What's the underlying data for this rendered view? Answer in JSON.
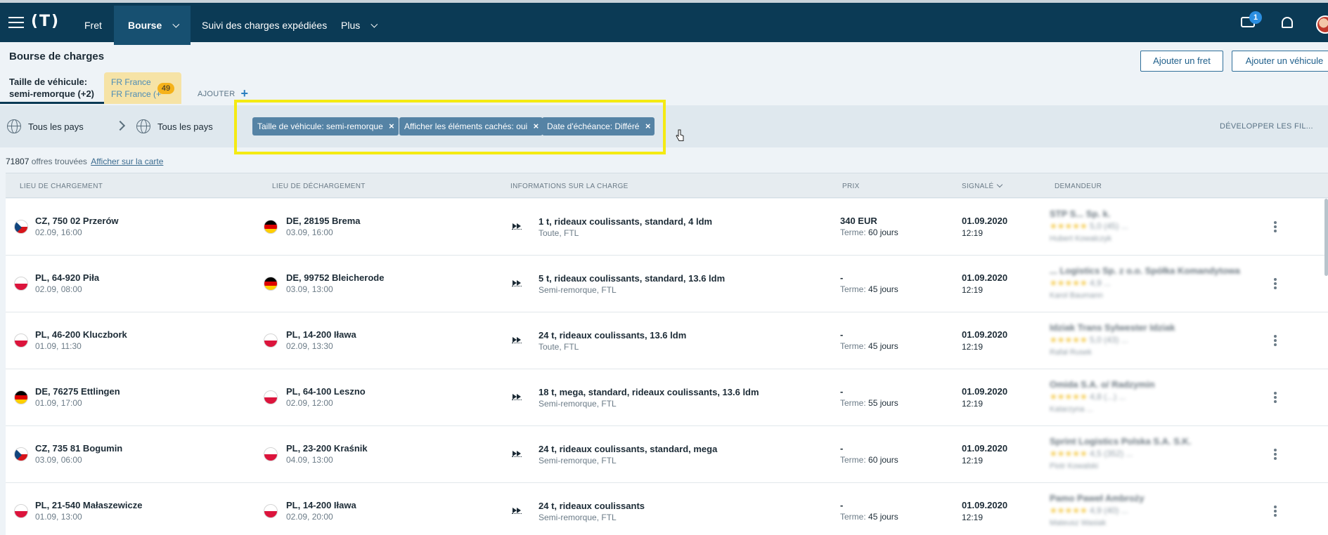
{
  "nav": {
    "logo": "(T)",
    "items": [
      {
        "label": "Fret",
        "active": false,
        "dropdown": false
      },
      {
        "label": "Bourse",
        "active": true,
        "dropdown": true
      },
      {
        "label": "Suivi des charges expédiées",
        "active": false,
        "dropdown": false
      },
      {
        "label": "Plus",
        "active": false,
        "dropdown": true
      }
    ],
    "messages_badge": "1"
  },
  "header": {
    "title": "Bourse de charges",
    "add_freight": "Ajouter un fret",
    "add_vehicle": "Ajouter un véhicule"
  },
  "tabs": {
    "size_line1": "Taille de véhicule:",
    "size_line2": "semi-remorque (+2)",
    "fr_line1": "FR France",
    "fr_line2": "FR France (+",
    "fr_count": "49",
    "add_label": "AJOUTER"
  },
  "filters": {
    "from_country": "Tous les pays",
    "to_country": "Tous les pays",
    "chips": [
      "Taille de véhicule: semi-remorque",
      "Afficher les éléments cachés: oui",
      "Date d'échéance: Différé"
    ],
    "expand_label": "DÉVELOPPER LES FIL..."
  },
  "results": {
    "count": "71807",
    "count_suffix": "offres trouvées",
    "map_link": "Afficher sur la carte"
  },
  "columns": {
    "loading": "LIEU DE CHARGEMENT",
    "unloading": "LIEU DE DÉCHARGEMENT",
    "info": "INFORMATIONS SUR LA CHARGE",
    "price": "PRIX",
    "reported": "SIGNALÉ",
    "requester": "DEMANDEUR"
  },
  "rows": [
    {
      "from_flag": "cz",
      "from": "CZ, 750 02 Przerów",
      "from_date": "02.09, 16:00",
      "to_flag": "de",
      "to": "DE, 28195 Brema",
      "to_date": "03.09, 16:00",
      "info": "1 t, rideaux coulissants, standard, 4 ldm",
      "info_sub": "Toute, FTL",
      "price": "340 EUR",
      "term_label": "Terme:",
      "term": "60 jours",
      "date": "01.09.2020",
      "time": "12:19",
      "req_name": "STP S... Sp. k.",
      "req_rating": "5,0 (45) ...",
      "req_person": "Hubert Kowalczyk"
    },
    {
      "from_flag": "pl",
      "from": "PL, 64-920 Piła",
      "from_date": "02.09, 08:00",
      "to_flag": "de",
      "to": "DE, 99752 Bleicherode",
      "to_date": "03.09, 13:00",
      "info": "5 t, rideaux coulissants, standard, 13.6 ldm",
      "info_sub": "Semi-remorque, FTL",
      "price": "-",
      "term_label": "Terme:",
      "term": "45 jours",
      "date": "01.09.2020",
      "time": "12:19",
      "req_name": "... Logistics Sp. z o.o. Spółka Komandytowa",
      "req_rating": "4,9 ...",
      "req_person": "Karol Baumann"
    },
    {
      "from_flag": "pl",
      "from": "PL, 46-200 Kluczbork",
      "from_date": "01.09, 11:30",
      "to_flag": "pl",
      "to": "PL, 14-200 Iława",
      "to_date": "02.09, 13:30",
      "info": "24 t, rideaux coulissants, 13.6 ldm",
      "info_sub": "Toute, FTL",
      "price": "-",
      "term_label": "Terme:",
      "term": "45 jours",
      "date": "01.09.2020",
      "time": "12:19",
      "req_name": "Idziak Trans Sylwester Idziak",
      "req_rating": "5,0 (43) ...",
      "req_person": "Rafał Rusek"
    },
    {
      "from_flag": "de",
      "from": "DE, 76275 Ettlingen",
      "from_date": "01.09, 17:00",
      "to_flag": "pl",
      "to": "PL, 64-100 Leszno",
      "to_date": "02.09, 12:00",
      "info": "18 t, mega, standard, rideaux coulissants, 13.6 ldm",
      "info_sub": "Semi-remorque, FTL",
      "price": "-",
      "term_label": "Terme:",
      "term": "55 jours",
      "date": "01.09.2020",
      "time": "12:19",
      "req_name": "Omida S.A. o/ Radzymin",
      "req_rating": "4,8 (...) ...",
      "req_person": "Katarzyna ..."
    },
    {
      "from_flag": "cz",
      "from": "CZ, 735 81 Bogumin",
      "from_date": "03.09, 06:00",
      "to_flag": "pl",
      "to": "PL, 23-200 Kraśnik",
      "to_date": "04.09, 13:00",
      "info": "24 t, rideaux coulissants, standard, mega",
      "info_sub": "Semi-remorque, FTL",
      "price": "-",
      "term_label": "Terme:",
      "term": "60 jours",
      "date": "01.09.2020",
      "time": "12:19",
      "req_name": "Sprint Logistics Polska S.A. S.K.",
      "req_rating": "4,5 (352) ...",
      "req_person": "Piotr Kowalski"
    },
    {
      "from_flag": "pl",
      "from": "PL, 21-540 Małaszewicze",
      "from_date": "01.09, 13:00",
      "to_flag": "pl",
      "to": "PL, 14-200 Iława",
      "to_date": "02.09, 20:00",
      "info": "24 t, rideaux coulissants",
      "info_sub": "Semi-remorque, FTL",
      "price": "-",
      "term_label": "Terme:",
      "term": "45 jours",
      "date": "01.09.2020",
      "time": "12:19",
      "req_name": "Pamo Paweł Ambroży",
      "req_rating": "4,9 (40) ...",
      "req_person": "Mateusz Wasiak"
    }
  ]
}
